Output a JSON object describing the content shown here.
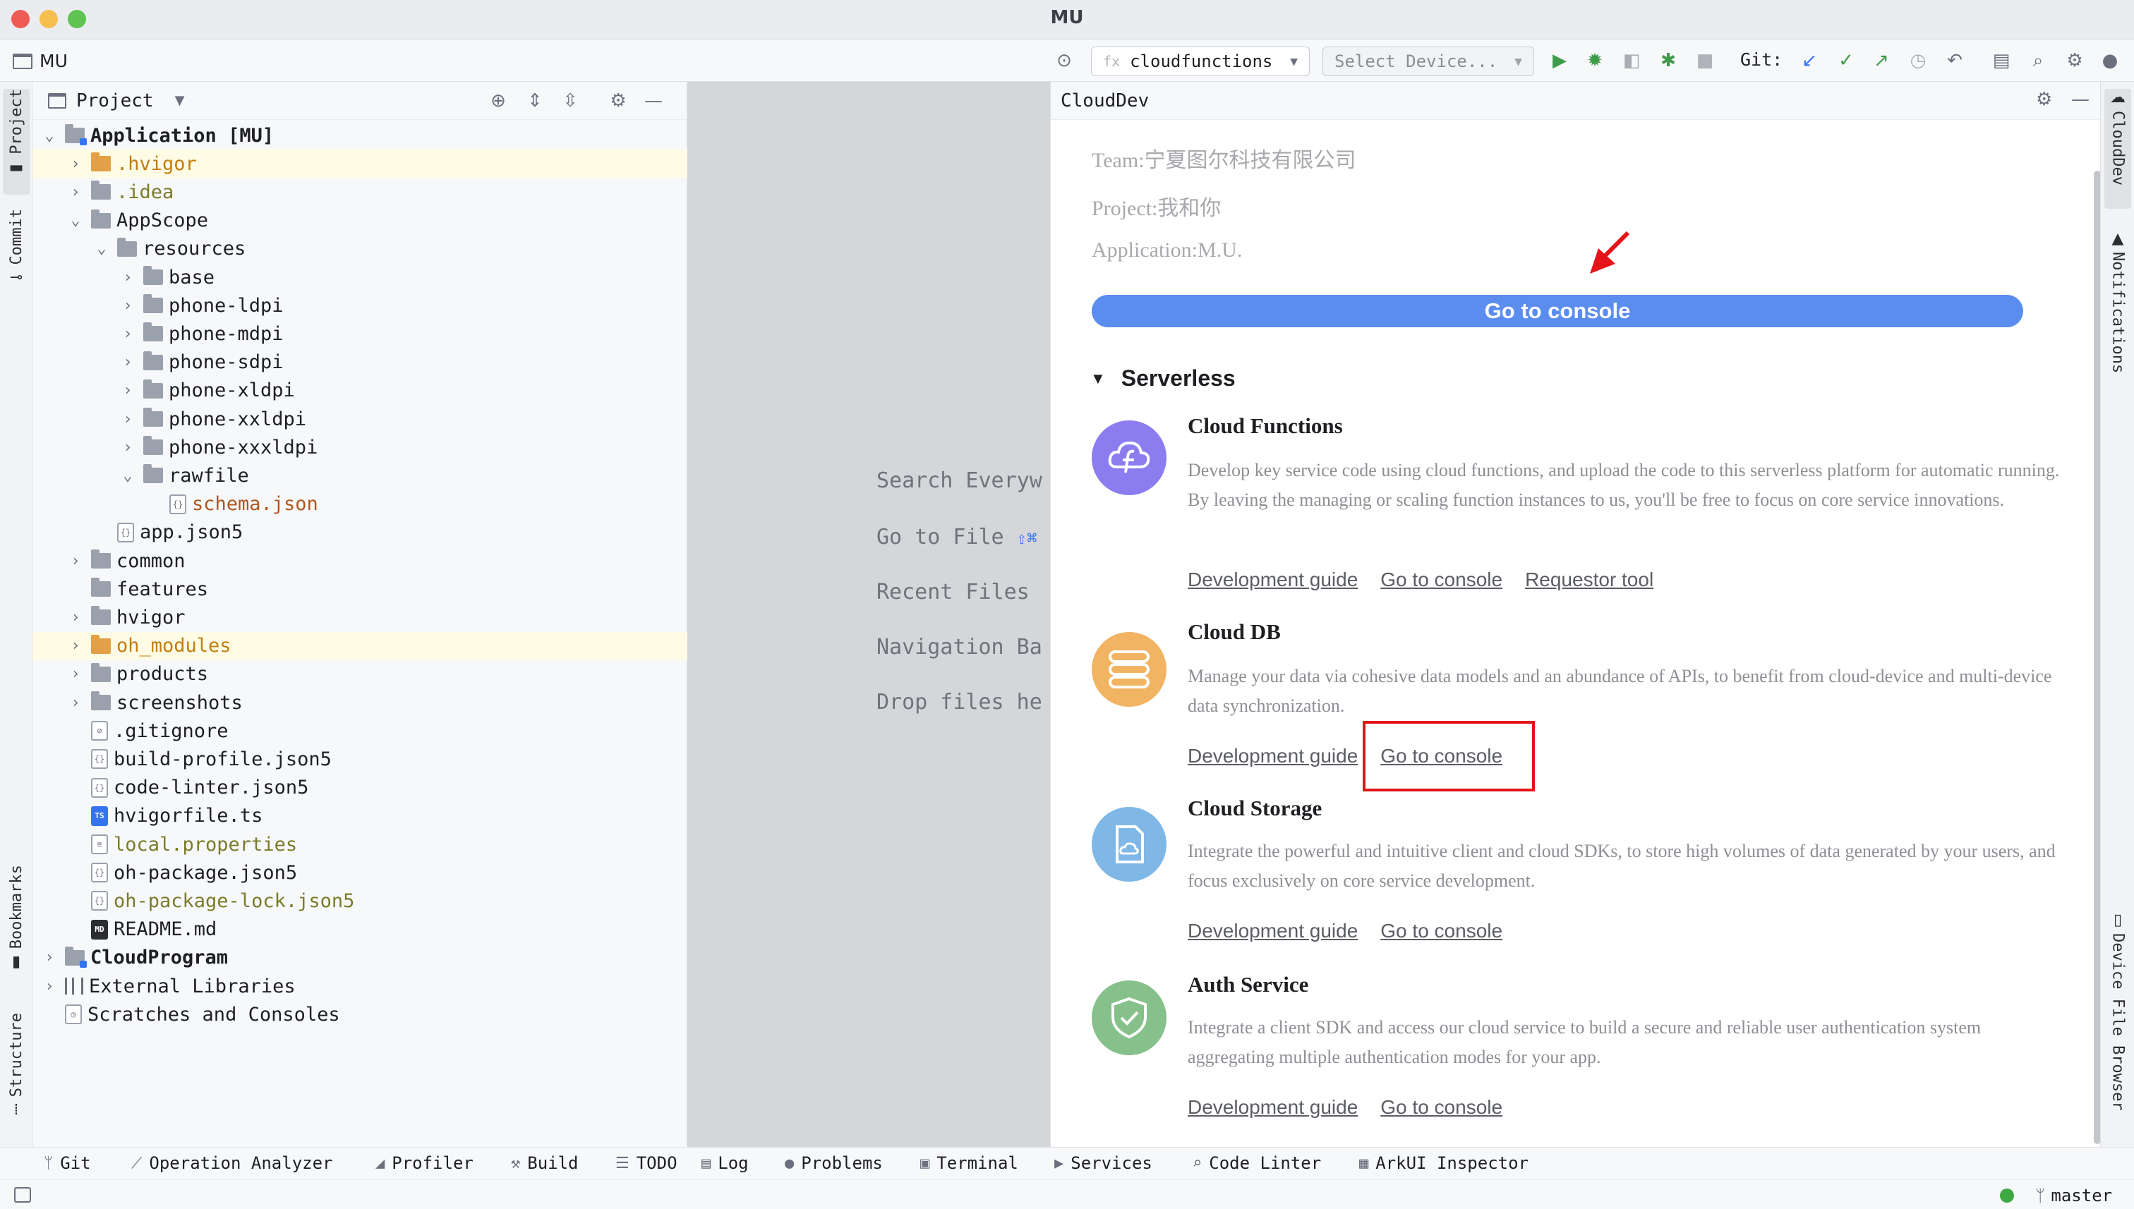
{
  "window": {
    "title": "MU"
  },
  "toolbar": {
    "project_name": "MU",
    "run_config": "cloudfunctions",
    "run_config_prefix": "fx",
    "device_select": "Select Device...",
    "git_label": "Git:"
  },
  "left_strip": {
    "tabs": [
      "Project",
      "Commit",
      "Bookmarks",
      "Structure"
    ]
  },
  "project_panel": {
    "title": "Project",
    "tree": [
      {
        "label": "Application [MU]",
        "depth": 0,
        "expanded": true,
        "icon": "module-folder",
        "bold": true
      },
      {
        "label": ".hvigor",
        "depth": 1,
        "expanded": false,
        "icon": "folder-orange",
        "style": "orange",
        "highlight": true
      },
      {
        "label": ".idea",
        "depth": 1,
        "expanded": false,
        "icon": "folder",
        "style": "olive"
      },
      {
        "label": "AppScope",
        "depth": 1,
        "expanded": true,
        "icon": "folder"
      },
      {
        "label": "resources",
        "depth": 2,
        "expanded": true,
        "icon": "folder"
      },
      {
        "label": "base",
        "depth": 3,
        "expanded": false,
        "icon": "folder"
      },
      {
        "label": "phone-ldpi",
        "depth": 3,
        "expanded": false,
        "icon": "folder"
      },
      {
        "label": "phone-mdpi",
        "depth": 3,
        "expanded": false,
        "icon": "folder"
      },
      {
        "label": "phone-sdpi",
        "depth": 3,
        "expanded": false,
        "icon": "folder"
      },
      {
        "label": "phone-xldpi",
        "depth": 3,
        "expanded": false,
        "icon": "folder"
      },
      {
        "label": "phone-xxldpi",
        "depth": 3,
        "expanded": false,
        "icon": "folder"
      },
      {
        "label": "phone-xxxldpi",
        "depth": 3,
        "expanded": false,
        "icon": "folder"
      },
      {
        "label": "rawfile",
        "depth": 3,
        "expanded": true,
        "icon": "folder"
      },
      {
        "label": "schema.json",
        "depth": 4,
        "icon": "json-file",
        "style": "red"
      },
      {
        "label": "app.json5",
        "depth": 2,
        "icon": "json-file"
      },
      {
        "label": "common",
        "depth": 1,
        "expanded": false,
        "icon": "folder"
      },
      {
        "label": "features",
        "depth": 1,
        "icon": "folder"
      },
      {
        "label": "hvigor",
        "depth": 1,
        "expanded": false,
        "icon": "folder"
      },
      {
        "label": "oh_modules",
        "depth": 1,
        "expanded": false,
        "icon": "folder-orange",
        "style": "orange",
        "highlight": true
      },
      {
        "label": "products",
        "depth": 1,
        "expanded": false,
        "icon": "folder"
      },
      {
        "label": "screenshots",
        "depth": 1,
        "expanded": false,
        "icon": "folder"
      },
      {
        "label": ".gitignore",
        "depth": 1,
        "icon": "gitignore-file"
      },
      {
        "label": "build-profile.json5",
        "depth": 1,
        "icon": "json-file"
      },
      {
        "label": "code-linter.json5",
        "depth": 1,
        "icon": "json-file"
      },
      {
        "label": "hvigorfile.ts",
        "depth": 1,
        "icon": "ts-file"
      },
      {
        "label": "local.properties",
        "depth": 1,
        "icon": "properties-file",
        "style": "olive"
      },
      {
        "label": "oh-package.json5",
        "depth": 1,
        "icon": "json-file"
      },
      {
        "label": "oh-package-lock.json5",
        "depth": 1,
        "icon": "json-file",
        "style": "olive"
      },
      {
        "label": "README.md",
        "depth": 1,
        "icon": "md-file"
      },
      {
        "label": "CloudProgram",
        "depth": 0,
        "expanded": false,
        "icon": "module-folder",
        "bold": true
      },
      {
        "label": "External Libraries",
        "depth": 0,
        "expanded": false,
        "icon": "library"
      },
      {
        "label": "Scratches and Consoles",
        "depth": 0,
        "icon": "scratches"
      }
    ]
  },
  "editor_hints": [
    {
      "text": "Search Everyw",
      "shortcut": ""
    },
    {
      "text": "Go to File ",
      "shortcut": "⇧⌘"
    },
    {
      "text": "Recent Files ",
      "shortcut": ""
    },
    {
      "text": "Navigation Ba",
      "shortcut": ""
    },
    {
      "text": "Drop files he",
      "shortcut": ""
    }
  ],
  "clouddev": {
    "title": "CloudDev",
    "team": "Team:宁夏图尔科技有限公司",
    "project": "Project:我和你",
    "application": "Application:M.U.",
    "go_to_console": "Go to console",
    "section": "Serverless",
    "services": [
      {
        "title": "Cloud Functions",
        "icon": "cloud-functions-icon",
        "color": "#8b7cf0",
        "desc": "Develop key service code using cloud functions, and upload the code to this serverless platform for automatic running. By leaving the managing or scaling function instances to us, you'll be free to focus on core service innovations.",
        "links": [
          "Development guide",
          "Go to console",
          "Requestor tool"
        ]
      },
      {
        "title": "Cloud DB",
        "icon": "database-icon",
        "color": "#f0b462",
        "desc": "Manage your data via cohesive data models and an abundance of APIs, to benefit from cloud-device and multi-device data synchronization.",
        "links": [
          "Development guide",
          "Go to console"
        ]
      },
      {
        "title": "Cloud Storage",
        "icon": "storage-icon",
        "color": "#7fb8e6",
        "desc": "Integrate the powerful and intuitive client and cloud SDKs, to store high volumes of data generated by your users, and focus exclusively on core service development.",
        "links": [
          "Development guide",
          "Go to console"
        ]
      },
      {
        "title": "Auth Service",
        "icon": "shield-check-icon",
        "color": "#86c08a",
        "desc": "Integrate a client SDK and access our cloud service to build a secure and reliable user authentication system aggregating multiple authentication modes for your app.",
        "links": [
          "Development guide",
          "Go to console"
        ]
      }
    ]
  },
  "right_strip": {
    "tabs": [
      "CloudDev",
      "Notifications",
      "Device File Browser"
    ]
  },
  "bottom_tabs": [
    "Git",
    "Operation Analyzer",
    "Profiler",
    "Build",
    "TODO",
    "Log",
    "Problems",
    "Terminal",
    "Services",
    "Code Linter",
    "ArkUI Inspector"
  ],
  "status_bar": {
    "branch": "master"
  },
  "colors": {
    "accent": "#3574f0",
    "annotation_red": "#e5141a",
    "console_button": "#5b8def"
  }
}
